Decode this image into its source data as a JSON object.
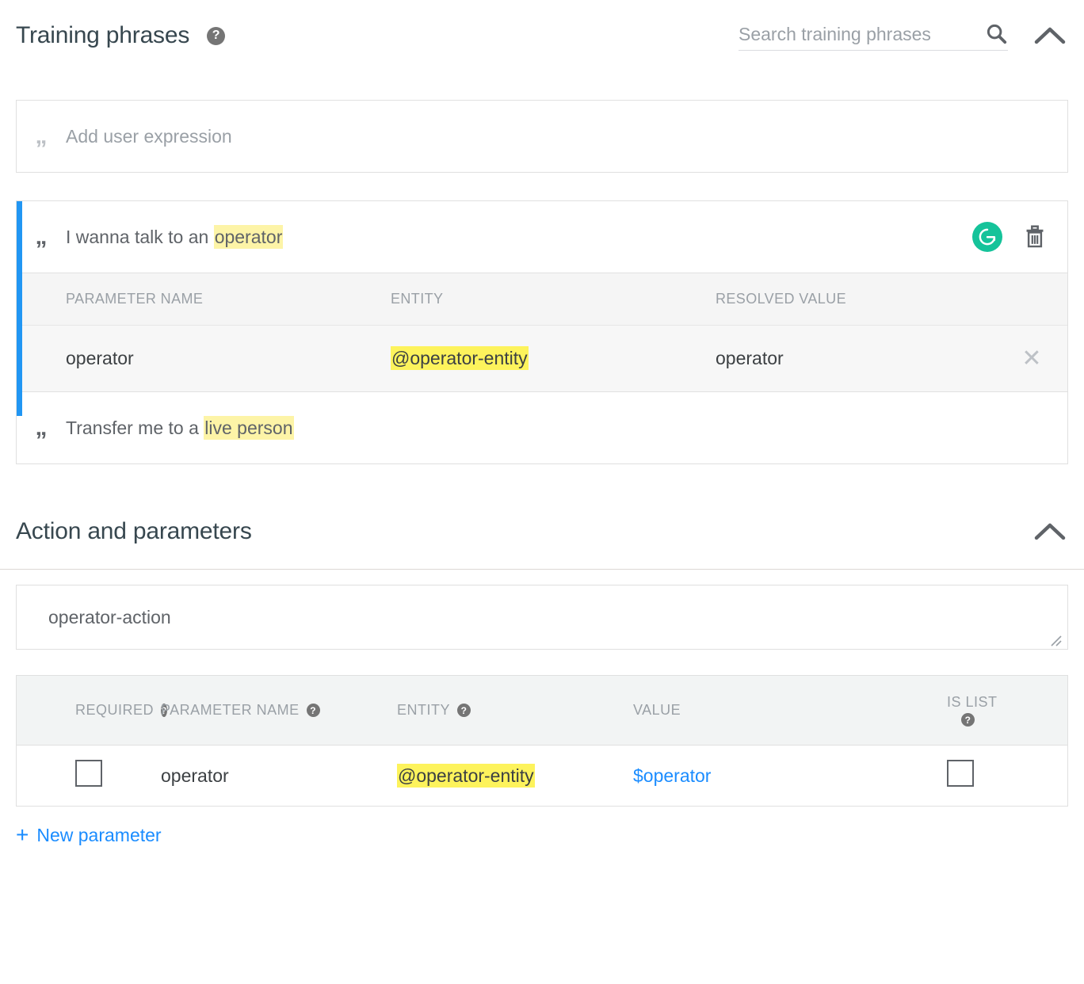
{
  "training_phrases": {
    "title": "Training phrases",
    "help_icon": "help-icon",
    "search": {
      "placeholder": "Search training phrases",
      "value": "",
      "icon": "search-icon"
    },
    "collapse_icon": "chevron-up-icon",
    "add_expression": {
      "placeholder": "Add user expression",
      "quote_icon": "quote-icon"
    },
    "phrases": [
      {
        "quote_icon": "quote-icon",
        "text_before": "I wanna talk to an ",
        "highlight": "operator",
        "text_after": "",
        "selected": true,
        "grammarly_icon": "grammarly-icon",
        "delete_icon": "trash-icon",
        "parameters": {
          "columns": [
            "PARAMETER NAME",
            "ENTITY",
            "RESOLVED VALUE"
          ],
          "rows": [
            {
              "parameter_name": "operator",
              "entity": "@operator-entity",
              "resolved_value": "operator",
              "remove_icon": "close-icon"
            }
          ]
        }
      },
      {
        "quote_icon": "quote-icon",
        "text_before": "Transfer me to a ",
        "highlight": "live person",
        "text_after": "",
        "selected": false
      }
    ]
  },
  "action_and_parameters": {
    "title": "Action and parameters",
    "collapse_icon": "chevron-up-icon",
    "action": {
      "value": "operator-action",
      "resize_icon": "resize-handle-icon"
    },
    "table": {
      "columns": [
        {
          "label": "REQUIRED",
          "help": true
        },
        {
          "label": "PARAMETER NAME",
          "help": true
        },
        {
          "label": "ENTITY",
          "help": true
        },
        {
          "label": "VALUE",
          "help": false
        },
        {
          "label": "IS LIST",
          "help": true
        }
      ],
      "rows": [
        {
          "required": false,
          "parameter_name": "operator",
          "entity": "@operator-entity",
          "value": "$operator",
          "is_list": false
        }
      ]
    },
    "new_parameter": {
      "label": "New parameter",
      "icon": "plus-icon"
    }
  },
  "colors": {
    "accent_blue": "#2196f3",
    "link_blue": "#1a8cff",
    "highlight_yellow": "#fdf4a7",
    "grammarly_green": "#15c39a"
  }
}
